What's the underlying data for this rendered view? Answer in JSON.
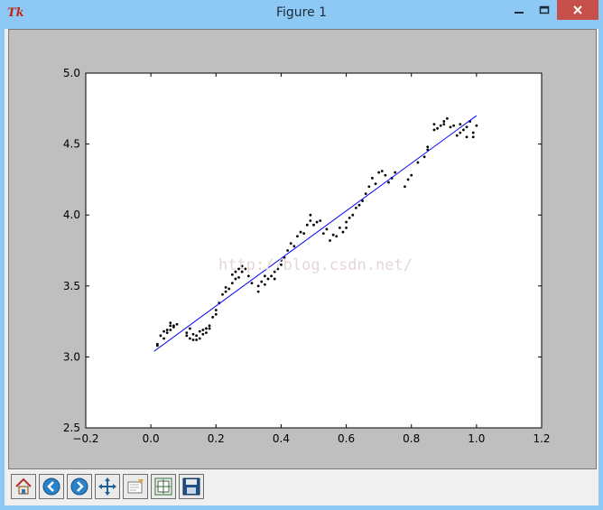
{
  "window": {
    "title": "Figure 1",
    "app_icon": "tk-icon",
    "app_icon_text": "Tk"
  },
  "watermark": "http://blog.csdn.net/",
  "toolbar": {
    "buttons": [
      {
        "name": "home-button",
        "icon": "home-icon"
      },
      {
        "name": "back-button",
        "icon": "arrow-left-icon"
      },
      {
        "name": "forward-button",
        "icon": "arrow-right-icon"
      },
      {
        "name": "pan-button",
        "icon": "move-arrows-icon"
      },
      {
        "name": "zoom-button",
        "icon": "zoom-rect-icon"
      },
      {
        "name": "subplots-button",
        "icon": "subplots-icon"
      },
      {
        "name": "save-button",
        "icon": "floppy-disk-icon"
      }
    ]
  },
  "colors": {
    "line": "#0000ff",
    "points": "#000000",
    "canvas_bg": "#bfbfbf",
    "axes_bg": "#ffffff",
    "titlebar": "#8ec9f5",
    "close_button": "#c7514a"
  },
  "chart_data": {
    "type": "scatter",
    "title": "",
    "xlabel": "",
    "ylabel": "",
    "xlim": [
      -0.2,
      1.2
    ],
    "ylim": [
      2.5,
      5.0
    ],
    "xticks": [
      "−0.2",
      "0.0",
      "0.2",
      "0.4",
      "0.6",
      "0.8",
      "1.0",
      "1.2"
    ],
    "xtick_values": [
      -0.2,
      0.0,
      0.2,
      0.4,
      0.6,
      0.8,
      1.0,
      1.2
    ],
    "yticks": [
      "2.5",
      "3.0",
      "3.5",
      "4.0",
      "4.5",
      "5.0"
    ],
    "ytick_values": [
      2.5,
      3.0,
      3.5,
      4.0,
      4.5,
      5.0
    ],
    "grid": false,
    "series": [
      {
        "kind": "line",
        "x": [
          0.01,
          1.0
        ],
        "y": [
          3.04,
          4.7
        ]
      },
      {
        "kind": "scatter",
        "x": [
          0.02,
          0.02,
          0.03,
          0.04,
          0.04,
          0.05,
          0.05,
          0.06,
          0.06,
          0.06,
          0.07,
          0.07,
          0.08,
          0.11,
          0.11,
          0.12,
          0.12,
          0.13,
          0.13,
          0.14,
          0.14,
          0.15,
          0.15,
          0.16,
          0.16,
          0.17,
          0.17,
          0.18,
          0.18,
          0.19,
          0.2,
          0.2,
          0.21,
          0.22,
          0.23,
          0.23,
          0.24,
          0.25,
          0.25,
          0.26,
          0.26,
          0.27,
          0.27,
          0.28,
          0.28,
          0.29,
          0.3,
          0.31,
          0.33,
          0.33,
          0.34,
          0.35,
          0.35,
          0.36,
          0.37,
          0.38,
          0.38,
          0.39,
          0.4,
          0.4,
          0.41,
          0.42,
          0.43,
          0.44,
          0.45,
          0.46,
          0.47,
          0.48,
          0.49,
          0.49,
          0.5,
          0.51,
          0.52,
          0.53,
          0.54,
          0.55,
          0.56,
          0.57,
          0.58,
          0.59,
          0.6,
          0.6,
          0.61,
          0.62,
          0.63,
          0.64,
          0.65,
          0.66,
          0.67,
          0.68,
          0.69,
          0.7,
          0.71,
          0.72,
          0.73,
          0.74,
          0.75,
          0.78,
          0.79,
          0.8,
          0.82,
          0.84,
          0.85,
          0.85,
          0.87,
          0.87,
          0.88,
          0.89,
          0.9,
          0.9,
          0.91,
          0.92,
          0.93,
          0.94,
          0.95,
          0.95,
          0.96,
          0.97,
          0.97,
          0.98,
          0.99,
          0.99,
          1.0
        ],
        "y": [
          3.08,
          3.09,
          3.15,
          3.18,
          3.13,
          3.19,
          3.17,
          3.22,
          3.19,
          3.24,
          3.22,
          3.21,
          3.23,
          3.17,
          3.15,
          3.2,
          3.13,
          3.12,
          3.16,
          3.12,
          3.15,
          3.18,
          3.13,
          3.19,
          3.16,
          3.2,
          3.17,
          3.2,
          3.22,
          3.28,
          3.3,
          3.33,
          3.38,
          3.44,
          3.46,
          3.49,
          3.48,
          3.52,
          3.58,
          3.55,
          3.6,
          3.62,
          3.56,
          3.64,
          3.6,
          3.62,
          3.57,
          3.52,
          3.5,
          3.46,
          3.53,
          3.57,
          3.51,
          3.55,
          3.57,
          3.6,
          3.55,
          3.62,
          3.65,
          3.68,
          3.7,
          3.75,
          3.8,
          3.78,
          3.85,
          3.88,
          3.87,
          3.93,
          3.96,
          4.0,
          3.93,
          3.95,
          3.96,
          3.87,
          3.9,
          3.82,
          3.86,
          3.85,
          3.91,
          3.88,
          3.95,
          3.91,
          3.98,
          4.0,
          4.05,
          4.07,
          4.1,
          4.15,
          4.2,
          4.26,
          4.22,
          4.3,
          4.31,
          4.28,
          4.23,
          4.26,
          4.3,
          4.2,
          4.25,
          4.28,
          4.37,
          4.41,
          4.46,
          4.48,
          4.6,
          4.64,
          4.61,
          4.63,
          4.64,
          4.66,
          4.68,
          4.62,
          4.63,
          4.56,
          4.58,
          4.64,
          4.6,
          4.55,
          4.62,
          4.66,
          4.58,
          4.55,
          4.63
        ]
      }
    ]
  }
}
